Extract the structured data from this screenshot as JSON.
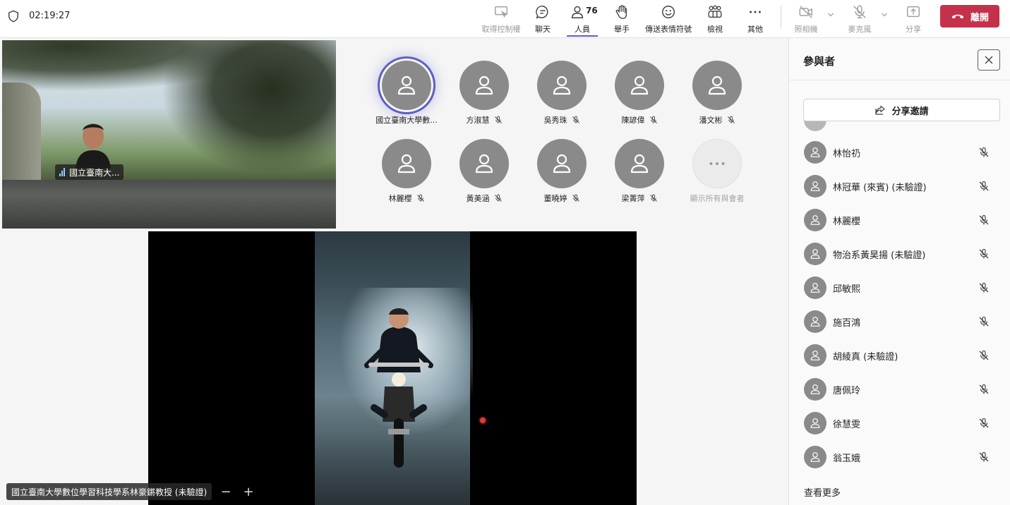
{
  "header": {
    "timer": "02:19:27",
    "participant_count": "76",
    "buttons": {
      "take_control": "取得控制權",
      "chat": "聊天",
      "people": "人員",
      "raise_hand": "舉手",
      "reactions": "傳送表情符號",
      "view": "檢視",
      "more": "其他",
      "camera": "照相機",
      "mic": "麥克風",
      "share": "分享",
      "leave": "離開"
    }
  },
  "self_video": {
    "name": "國立臺南大..."
  },
  "gallery": {
    "participants": [
      {
        "name": "國立臺南大學數..."
      },
      {
        "name": "方淑慧"
      },
      {
        "name": "吳秀珠"
      },
      {
        "name": "陳諺偉"
      },
      {
        "name": "潘文彬"
      },
      {
        "name": "林麗櫻"
      },
      {
        "name": "黃美涵"
      },
      {
        "name": "董曉婷"
      },
      {
        "name": "梁菁萍"
      }
    ],
    "show_all": "顯示所有與會者"
  },
  "shared_content": {
    "presenter": "國立臺南大學數位學習科技學系林豪鏘教授 (未驗證)",
    "zoom_out": "−",
    "zoom_in": "+"
  },
  "panel": {
    "title": "參與者",
    "invite": "分享邀請",
    "attendees": [
      {
        "name": "林怡礽"
      },
      {
        "name": "林冠華 (來賓) (未驗證)"
      },
      {
        "name": "林麗櫻"
      },
      {
        "name": "物治系黃昊揚 (未驗證)"
      },
      {
        "name": "邱敏熙"
      },
      {
        "name": "施百鴻"
      },
      {
        "name": "胡綾真 (未驗證)"
      },
      {
        "name": "唐佩玲"
      },
      {
        "name": "徐慧雯"
      },
      {
        "name": "翁玉娥"
      }
    ],
    "see_more": "查看更多"
  }
}
